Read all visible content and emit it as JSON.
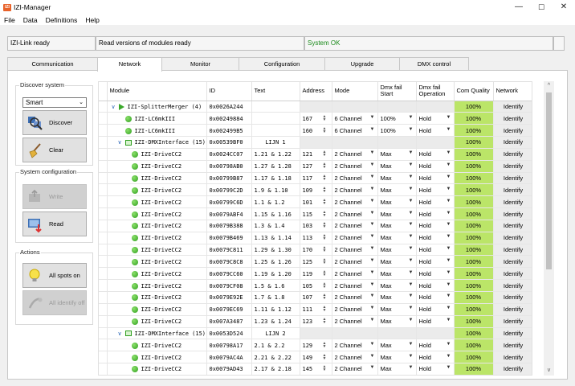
{
  "app": {
    "title": "IZI-Manager",
    "icon_text": "IZI"
  },
  "window_controls": {
    "minimize": "—",
    "maximize": "☐",
    "close": "✕"
  },
  "menu": [
    "File",
    "Data",
    "Definitions",
    "Help"
  ],
  "status": {
    "link": "IZI-Link ready",
    "message": "Read versions of modules ready",
    "system": "System OK",
    "empty": "",
    "ok_color": "#1a8a1a"
  },
  "tabs": [
    "Communication",
    "Network",
    "Monitor",
    "Configuration",
    "Upgrade",
    "DMX control"
  ],
  "active_tab": "Network",
  "left_panel": {
    "discover_title": "Discover system",
    "mode_value": "Smart",
    "discover_label": "Discover",
    "clear_label": "Clear",
    "config_title": "System configuration",
    "write_label": "Write",
    "read_label": "Read",
    "actions_title": "Actions",
    "all_spots_on_label": "All spots on",
    "all_identify_off_label": "All identify off"
  },
  "grid": {
    "columns": [
      "Module",
      "ID",
      "Text",
      "Address",
      "Mode",
      "Dmx fail Start",
      "Dmx fail Operation",
      "Com Quality",
      "Network"
    ],
    "quality_color": "#bbe568",
    "rows": [
      {
        "level": 0,
        "kind": "merger",
        "module": "IZI-SplitterMerger (4)",
        "id": "0x0026A244",
        "text": "",
        "address": "",
        "mode": "",
        "start": "",
        "operation": "",
        "quality": "100%",
        "network": "Identify"
      },
      {
        "level": 1,
        "kind": "device",
        "module": "IZI-LC6mkIII",
        "id": "0x00249884",
        "text": "",
        "address": "167",
        "mode": "6 Channel",
        "start": "100%",
        "operation": "Hold",
        "quality": "100%",
        "network": "Identify"
      },
      {
        "level": 1,
        "kind": "device",
        "module": "IZI-LC6mkIII",
        "id": "0x002499B5",
        "text": "",
        "address": "160",
        "mode": "6 Channel",
        "start": "100%",
        "operation": "Hold",
        "quality": "100%",
        "network": "Identify"
      },
      {
        "level": 1,
        "kind": "interface",
        "module": "IZI-DMXInterface (15)",
        "id": "0x00539BF0",
        "text": "LIJN 1",
        "address": "",
        "mode": "",
        "start": "",
        "operation": "",
        "quality": "100%",
        "network": "Identify"
      },
      {
        "level": 2,
        "kind": "device",
        "module": "IZI-DriveCC2",
        "id": "0x0024CC07",
        "text": "1.21 & 1.22",
        "address": "121",
        "mode": "2 Channel",
        "start": "Max",
        "operation": "Hold",
        "quality": "100%",
        "network": "Identify"
      },
      {
        "level": 2,
        "kind": "device",
        "module": "IZI-DriveCC2",
        "id": "0x00798AB0",
        "text": "1.27 & 1.28",
        "address": "127",
        "mode": "2 Channel",
        "start": "Max",
        "operation": "Hold",
        "quality": "100%",
        "network": "Identify"
      },
      {
        "level": 2,
        "kind": "device",
        "module": "IZI-DriveCC2",
        "id": "0x00799B87",
        "text": "1.17 & 1.18",
        "address": "117",
        "mode": "2 Channel",
        "start": "Max",
        "operation": "Hold",
        "quality": "100%",
        "network": "Identify"
      },
      {
        "level": 2,
        "kind": "device",
        "module": "IZI-DriveCC2",
        "id": "0x00799C2D",
        "text": "1.9 & 1.10",
        "address": "109",
        "mode": "2 Channel",
        "start": "Max",
        "operation": "Hold",
        "quality": "100%",
        "network": "Identify"
      },
      {
        "level": 2,
        "kind": "device",
        "module": "IZI-DriveCC2",
        "id": "0x00799C6D",
        "text": "1.1 & 1.2",
        "address": "101",
        "mode": "2 Channel",
        "start": "Max",
        "operation": "Hold",
        "quality": "100%",
        "network": "Identify"
      },
      {
        "level": 2,
        "kind": "device",
        "module": "IZI-DriveCC2",
        "id": "0x0079ABF4",
        "text": "1.15 & 1.16",
        "address": "115",
        "mode": "2 Channel",
        "start": "Max",
        "operation": "Hold",
        "quality": "100%",
        "network": "Identify"
      },
      {
        "level": 2,
        "kind": "device",
        "module": "IZI-DriveCC2",
        "id": "0x0079B388",
        "text": "1.3 & 1.4",
        "address": "103",
        "mode": "2 Channel",
        "start": "Max",
        "operation": "Hold",
        "quality": "100%",
        "network": "Identify"
      },
      {
        "level": 2,
        "kind": "device",
        "module": "IZI-DriveCC2",
        "id": "0x0079B469",
        "text": "1.13 & 1.14",
        "address": "113",
        "mode": "2 Channel",
        "start": "Max",
        "operation": "Hold",
        "quality": "100%",
        "network": "Identify"
      },
      {
        "level": 2,
        "kind": "device",
        "module": "IZI-DriveCC2",
        "id": "0x0079C811",
        "text": "1.29 & 1.30",
        "address": "170",
        "mode": "2 Channel",
        "start": "Max",
        "operation": "Hold",
        "quality": "100%",
        "network": "Identify"
      },
      {
        "level": 2,
        "kind": "device",
        "module": "IZI-DriveCC2",
        "id": "0x0079C8C8",
        "text": "1.25 & 1.26",
        "address": "125",
        "mode": "2 Channel",
        "start": "Max",
        "operation": "Hold",
        "quality": "100%",
        "network": "Identify"
      },
      {
        "level": 2,
        "kind": "device",
        "module": "IZI-DriveCC2",
        "id": "0x0079CC60",
        "text": "1.19 & 1.20",
        "address": "119",
        "mode": "2 Channel",
        "start": "Max",
        "operation": "Hold",
        "quality": "100%",
        "network": "Identify"
      },
      {
        "level": 2,
        "kind": "device",
        "module": "IZI-DriveCC2",
        "id": "0x0079CF08",
        "text": "1.5 & 1.6",
        "address": "105",
        "mode": "2 Channel",
        "start": "Max",
        "operation": "Hold",
        "quality": "100%",
        "network": "Identify"
      },
      {
        "level": 2,
        "kind": "device",
        "module": "IZI-DriveCC2",
        "id": "0x0079E92E",
        "text": "1.7 & 1.8",
        "address": "107",
        "mode": "2 Channel",
        "start": "Max",
        "operation": "Hold",
        "quality": "100%",
        "network": "Identify"
      },
      {
        "level": 2,
        "kind": "device",
        "module": "IZI-DriveCC2",
        "id": "0x0079EC69",
        "text": "1.11 & 1.12",
        "address": "111",
        "mode": "2 Channel",
        "start": "Max",
        "operation": "Hold",
        "quality": "100%",
        "network": "Identify"
      },
      {
        "level": 2,
        "kind": "device",
        "module": "IZI-DriveCC2",
        "id": "0x007A3487",
        "text": "1.23 & 1.24",
        "address": "123",
        "mode": "2 Channel",
        "start": "Max",
        "operation": "Hold",
        "quality": "100%",
        "network": "Identify"
      },
      {
        "level": 1,
        "kind": "interface",
        "module": "IZI-DMXInterface (15)",
        "id": "0x0053D524",
        "text": "LIJN 2",
        "address": "",
        "mode": "",
        "start": "",
        "operation": "",
        "quality": "100%",
        "network": "Identify"
      },
      {
        "level": 2,
        "kind": "device",
        "module": "IZI-DriveCC2",
        "id": "0x00798A17",
        "text": "2.1 & 2.2",
        "address": "129",
        "mode": "2 Channel",
        "start": "Max",
        "operation": "Hold",
        "quality": "100%",
        "network": "Identify"
      },
      {
        "level": 2,
        "kind": "device",
        "module": "IZI-DriveCC2",
        "id": "0x0079AC4A",
        "text": "2.21 & 2.22",
        "address": "149",
        "mode": "2 Channel",
        "start": "Max",
        "operation": "Hold",
        "quality": "100%",
        "network": "Identify"
      },
      {
        "level": 2,
        "kind": "device",
        "module": "IZI-DriveCC2",
        "id": "0x0079AD43",
        "text": "2.17 & 2.18",
        "address": "145",
        "mode": "2 Channel",
        "start": "Max",
        "operation": "Hold",
        "quality": "100%",
        "network": "Identify"
      }
    ]
  },
  "scrollbar": {
    "up": "^",
    "down": "v"
  }
}
